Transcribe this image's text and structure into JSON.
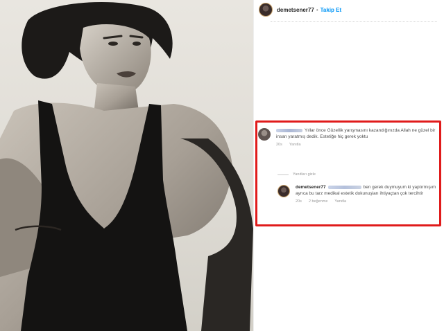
{
  "post": {
    "username": "demetsener77",
    "follow_label": "Takip Et",
    "separator": "•"
  },
  "comment": {
    "text": "Yıllar önce Güzellik yarışmasını kazandığınızda Allah ne güzel bir insan yaratmış dedik. Estetiğe hiç gerek yoktu",
    "time": "20s",
    "reply_label": "Yanıtla"
  },
  "replies_toggle": {
    "label": "Yanıtları gizle"
  },
  "reply": {
    "username": "demetsener77",
    "text": "ben gerek duymuyum ki yaptırmışım ayrıca bu tarz medikal estetik dokunuşları ihtiyaçtan çok tercihtir",
    "time": "20s",
    "likes": "2 beğenme",
    "reply_label": "Yanıtla"
  },
  "colors": {
    "highlight": "#e01b1b",
    "follow": "#0095f6"
  }
}
